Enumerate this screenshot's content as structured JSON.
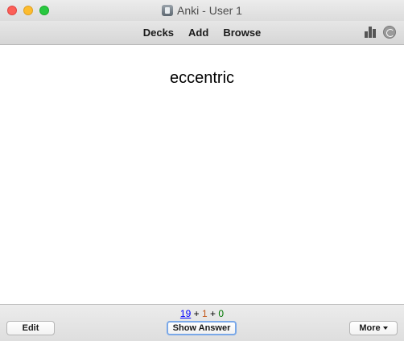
{
  "window": {
    "title": "Anki - User 1"
  },
  "toolbar": {
    "nav": [
      "Decks",
      "Add",
      "Browse"
    ],
    "icons": [
      "stats-icon",
      "sync-icon"
    ]
  },
  "card": {
    "front": "eccentric"
  },
  "counts": {
    "new": "19",
    "learn": "1",
    "review": "0",
    "separator": "+"
  },
  "buttons": {
    "edit": "Edit",
    "show_answer": "Show Answer",
    "more": "More"
  },
  "colors": {
    "new_count": "#0000ff",
    "learn_count": "#c35617",
    "review_count": "#007700",
    "focus_ring": "#7aa8e8"
  }
}
